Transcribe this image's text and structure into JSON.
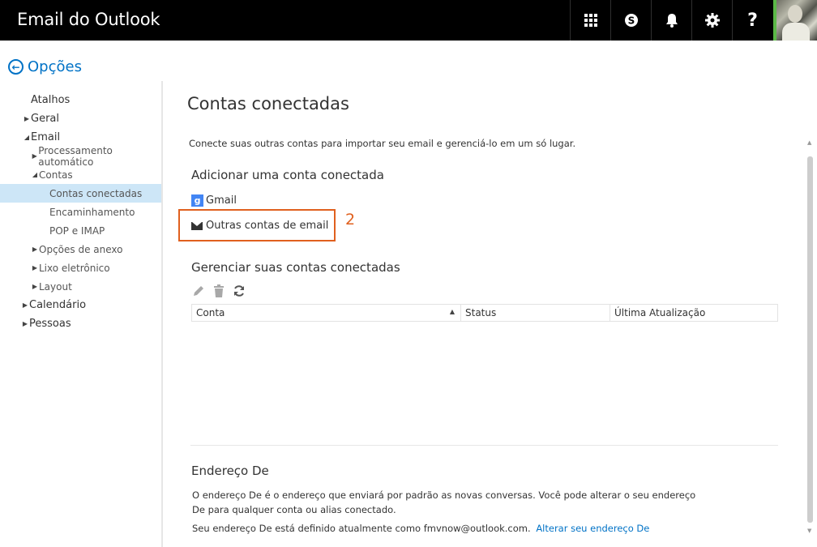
{
  "header": {
    "brand": "Email do Outlook",
    "help_glyph": "?",
    "icons": [
      "apps-grid-icon",
      "skype-icon",
      "bell-icon",
      "gear-icon",
      "help-icon",
      "user-avatar"
    ]
  },
  "options": {
    "back_label": "Opções"
  },
  "sidebar": {
    "items": [
      {
        "label": "Atalhos",
        "arrow": ""
      },
      {
        "label": "Geral",
        "arrow": "▶"
      },
      {
        "label": "Email",
        "arrow": "◢"
      },
      {
        "label": "Processamento automático",
        "arrow": "▶"
      },
      {
        "label": "Contas",
        "arrow": "◢"
      },
      {
        "label": "Contas conectadas",
        "arrow": "",
        "selected": true
      },
      {
        "label": "Encaminhamento",
        "arrow": ""
      },
      {
        "label": "POP e IMAP",
        "arrow": ""
      },
      {
        "label": "Opções de anexo",
        "arrow": "▶"
      },
      {
        "label": "Lixo eletrônico",
        "arrow": "▶"
      },
      {
        "label": "Layout",
        "arrow": "▶"
      },
      {
        "label": "Calendário",
        "arrow": "▶"
      },
      {
        "label": "Pessoas",
        "arrow": "▶"
      }
    ]
  },
  "main": {
    "title": "Contas conectadas",
    "description": "Conecte suas outras contas para importar seu email e gerenciá-lo em um só lugar.",
    "add_heading": "Adicionar uma conta conectada",
    "gmail_label": "Gmail",
    "gmail_glyph": "g",
    "other_label": "Outras contas de email",
    "callout_number": "2",
    "manage_heading": "Gerenciar suas contas conectadas",
    "toolbar_icons": [
      "edit-icon",
      "delete-icon",
      "refresh-icon"
    ],
    "table_headers": [
      "Conta",
      "Status",
      "Última Atualização"
    ],
    "from_heading": "Endereço De",
    "from_text": "O endereço De é o endereço que enviará por padrão as novas conversas. Você pode alterar o seu endereço De para qualquer conta ou alias conectado.",
    "from_current": "Seu endereço De está definido atualmente como fmvnow@outlook.com.",
    "from_link": "Alterar seu endereço De"
  },
  "colors": {
    "topbar": "#000000",
    "accent": "#0072c6",
    "selected_bg": "#cde6f7",
    "callout": "#e0601e",
    "presence": "#5bb947"
  }
}
